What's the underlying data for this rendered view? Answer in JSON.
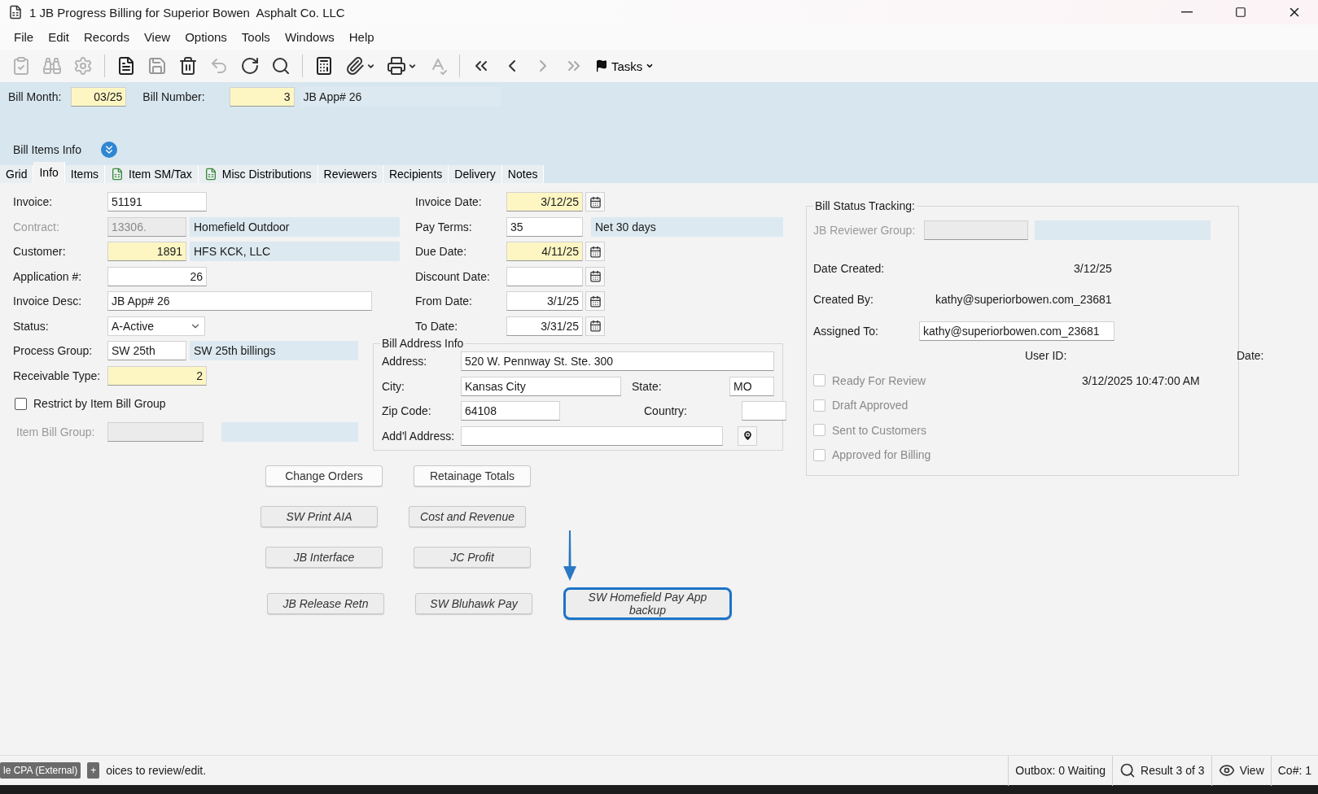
{
  "window": {
    "title": "1 JB Progress Billing for Superior Bowen  Asphalt Co. LLC"
  },
  "menu": [
    "File",
    "Edit",
    "Records",
    "View",
    "Options",
    "Tools",
    "Windows",
    "Help"
  ],
  "toolbar": {
    "tasks": "Tasks"
  },
  "header": {
    "bill_month": {
      "label": "Bill Month:",
      "value": "03/25"
    },
    "bill_number": {
      "label": "Bill Number:",
      "value": "3",
      "description": "JB App# 26"
    },
    "section": "Bill Items Info"
  },
  "tabs": [
    {
      "label": "Grid",
      "selected": false
    },
    {
      "label": "Info",
      "selected": true
    },
    {
      "label": "Items",
      "selected": false
    },
    {
      "label": "Item SM/Tax",
      "selected": false,
      "kind": "icon"
    },
    {
      "label": "Misc Distributions",
      "selected": false,
      "kind": "icon"
    },
    {
      "label": "Reviewers",
      "selected": false
    },
    {
      "label": "Recipients",
      "selected": false
    },
    {
      "label": "Delivery",
      "selected": false
    },
    {
      "label": "Notes",
      "selected": false
    }
  ],
  "form_left": [
    {
      "label": "Invoice:",
      "value": "51191",
      "kind": "text",
      "required": false,
      "disabled": false,
      "right_aligned": false
    },
    {
      "label": "Contract:",
      "value": "13306.",
      "kind": "text",
      "required": false,
      "disabled": true,
      "right_aligned": false,
      "description": "Homefield Outdoor"
    },
    {
      "label": "Customer:",
      "value": "1891",
      "kind": "text",
      "required": true,
      "disabled": false,
      "right_aligned": true,
      "description": "HFS KCK, LLC"
    },
    {
      "label": "Application #:",
      "value": "26",
      "kind": "text",
      "required": false,
      "disabled": false,
      "right_aligned": true
    },
    {
      "label": "Invoice Desc:",
      "value": "JB App# 26",
      "kind": "long",
      "required": false,
      "disabled": false,
      "right_aligned": false
    },
    {
      "label": "Status:",
      "value": "A-Active",
      "kind": "select"
    }
  ],
  "form_left_lower": [
    {
      "label": "Process Group:",
      "value": "SW 25th",
      "kind": "text",
      "required": false,
      "disabled": false,
      "right_aligned": false,
      "description": "SW 25th billings"
    },
    {
      "label": "Receivable Type:",
      "value": "2",
      "kind": "text",
      "required": true,
      "disabled": false,
      "right_aligned": true
    }
  ],
  "restrict": {
    "label": "Restrict by Item Bill Group",
    "checked": false
  },
  "item_bill_group": {
    "label": "Item Bill Group:",
    "disabled": true
  },
  "form_middle": [
    {
      "label": "Invoice Date:",
      "value": "3/12/25",
      "required": true,
      "right_aligned": true,
      "calendar": true
    },
    {
      "label": "Pay Terms:",
      "value": "35",
      "required": false,
      "right_aligned": false,
      "calendar": false,
      "description": "Net 30 days"
    },
    {
      "label": "Due Date:",
      "value": "4/11/25",
      "required": true,
      "right_aligned": true,
      "calendar": true
    },
    {
      "label": "Discount Date:",
      "required": false,
      "right_aligned": true,
      "calendar": true
    },
    {
      "label": "From Date:",
      "value": "3/1/25",
      "required": false,
      "right_aligned": true,
      "calendar": true
    },
    {
      "label": "To Date:",
      "value": "3/31/25",
      "required": false,
      "right_aligned": true,
      "calendar": true
    }
  ],
  "bill_address": {
    "title": "Bill Address Info",
    "address": {
      "label": "Address:",
      "value": "520 W. Pennway St. Ste. 300"
    },
    "city": {
      "label": "City:",
      "value": "Kansas City"
    },
    "state": {
      "label": "State:",
      "value": "MO"
    },
    "zip": {
      "label": "Zip Code:",
      "value": "64108"
    },
    "country": {
      "label": "Country:"
    },
    "addl": {
      "label": "Add'l Address:"
    }
  },
  "status_tracking": {
    "title": "Bill Status Tracking:",
    "reviewer_group": {
      "label": "JB Reviewer Group:",
      "disabled": true
    },
    "date_created": {
      "label": "Date Created:",
      "value": "3/12/25"
    },
    "created_by": {
      "label": "Created By:",
      "value": "kathy@superiorbowen.com_23681"
    },
    "assigned_to": {
      "label": "Assigned To:",
      "value": "kathy@superiorbowen.com_23681"
    },
    "user_id_heading": "User ID:",
    "date_heading": "Date:",
    "checks": [
      {
        "label": "Ready For Review",
        "checked": false,
        "disabled": true,
        "date": "3/12/2025 10:47:00 AM"
      },
      {
        "label": "Draft Approved",
        "checked": false,
        "disabled": true
      },
      {
        "label": "Sent to Customers",
        "checked": false,
        "disabled": true
      },
      {
        "label": "Approved for Billing",
        "checked": false,
        "disabled": true
      }
    ]
  },
  "button_rows": [
    [
      {
        "label": "Change Orders",
        "kind": "standard",
        "focused": false
      },
      {
        "label": "Retainage Totals",
        "kind": "standard",
        "focused": false
      }
    ],
    [
      {
        "label": "SW Print AIA",
        "kind": "custom",
        "focused": false
      },
      {
        "label": "Cost and Revenue",
        "kind": "custom",
        "focused": false
      }
    ],
    [
      {
        "label": "JB Interface",
        "kind": "custom",
        "focused": false
      },
      {
        "label": "JC Profit",
        "kind": "custom",
        "focused": false
      }
    ],
    [
      {
        "label": "JB Release Retn",
        "kind": "custom",
        "focused": false
      },
      {
        "label": "SW Bluhawk Pay",
        "kind": "custom",
        "focused": false
      },
      {
        "label": "SW Homefield Pay App backup",
        "kind": "custom",
        "focused": true
      }
    ]
  ],
  "status_bar": {
    "chips": [
      "le CPA (External)",
      "+"
    ],
    "message": "oices to review/edit.",
    "outbox": "Outbox: 0 Waiting",
    "result": "Result 3 of 3",
    "view": "View",
    "company": "Co#: 1"
  }
}
